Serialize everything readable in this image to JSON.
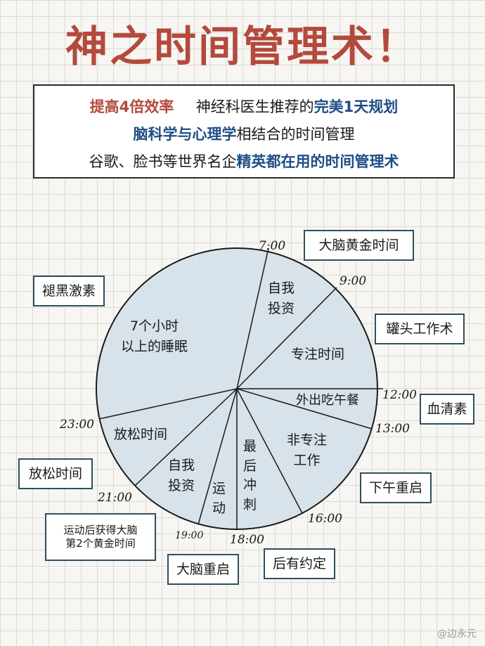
{
  "title": "神之时间管理术！",
  "intro": {
    "line1_a": "提高4倍效率",
    "line1_b": "神经科医生推荐的",
    "line1_c": "完美1天规划",
    "line2_a": "脑科学与心理学",
    "line2_b": "相结合的时间管理",
    "line3_a": "谷歌、脸书等世界名企",
    "line3_b": "精英都在用的时间管理术"
  },
  "labels": {
    "golden": "大脑黄金时间",
    "melatonin": "褪黑激素",
    "canned": "罐头工作术",
    "serotonin": "血清素",
    "relax": "放松时间",
    "restart_afternoon": "下午重启",
    "after_exercise_1": "运动后获得大脑",
    "after_exercise_2": "第2个黄金时间",
    "brain_restart": "大脑重启",
    "appointment": "后有约定"
  },
  "times": {
    "t700": "7:00",
    "t900": "9:00",
    "t1200": "12:00",
    "t1300": "13:00",
    "t1600": "16:00",
    "t1800": "18:00",
    "t1900": "19:00",
    "t2100": "21:00",
    "t2300": "23:00"
  },
  "segments": {
    "sleep_1": "7个小时",
    "sleep_2": "以上的睡眠",
    "self_invest_am_1": "自我",
    "self_invest_am_2": "投资",
    "focus": "专注时间",
    "lunch": "外出吃午餐",
    "nonfocus_1": "非专注",
    "nonfocus_2": "工作",
    "final_1": "最",
    "final_2": "后",
    "final_3": "冲",
    "final_4": "刺",
    "exercise_1": "运",
    "exercise_2": "动",
    "self_invest_pm_1": "自我",
    "self_invest_pm_2": "投资",
    "relax_seg": "放松时间"
  },
  "colors": {
    "title": "#b34a3c",
    "highlight_red": "#b34a3c",
    "highlight_blue": "#1f4d86",
    "pie_fill": "#d8e2ea",
    "box_border": "#2f4f5f"
  },
  "watermark": "@边永元"
}
